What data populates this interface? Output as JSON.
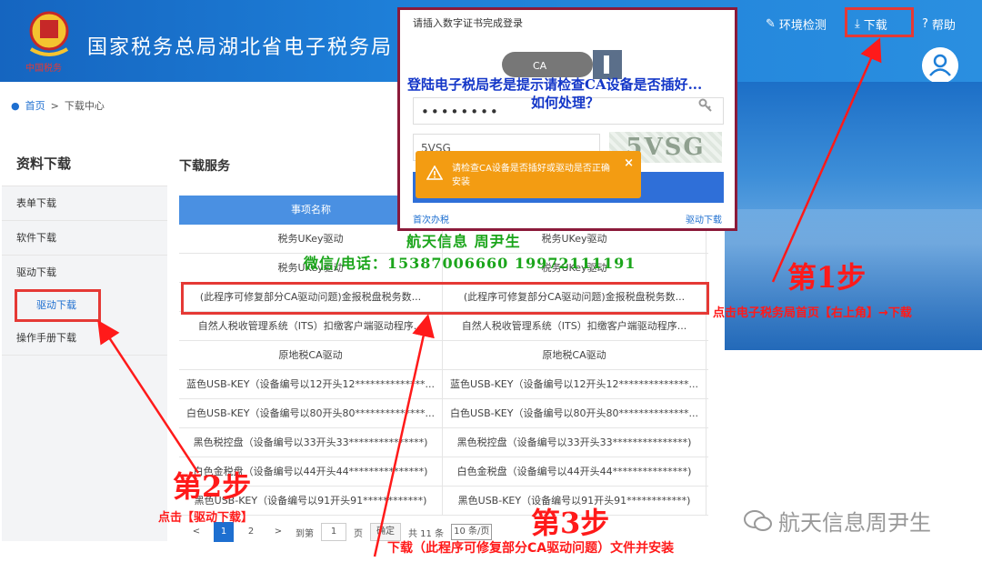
{
  "header": {
    "site_title": "国家税务总局湖北省电子税务局",
    "emblem_text": "中国税务",
    "env_check_label": "环境检测",
    "download_label": "下载",
    "help_label": "帮助",
    "login_label": "登录"
  },
  "breadcrumb": {
    "home": "首页",
    "separator": ">",
    "current": "下载中心"
  },
  "sidebar": {
    "title": "资料下载",
    "items": [
      {
        "label": "表单下载"
      },
      {
        "label": "软件下载"
      },
      {
        "label": "驱动下载"
      }
    ],
    "sub_item": "驱动下载",
    "last_item": "操作手册下载"
  },
  "main": {
    "title": "下载服务",
    "table": {
      "header": "事项名称",
      "rows": [
        [
          "税务UKey驱动",
          "税务UKey驱动"
        ],
        [
          "税务UKey驱动",
          "税务UKey驱动"
        ],
        [
          "(此程序可修复部分CA驱动问题)金报税盘税务数...",
          "(此程序可修复部分CA驱动问题)金报税盘税务数..."
        ],
        [
          "自然人税收管理系统（ITS）扣缴客户端驱动程序...",
          "自然人税收管理系统（ITS）扣缴客户端驱动程序..."
        ],
        [
          "原地税CA驱动",
          "原地税CA驱动"
        ],
        [
          "蓝色USB-KEY（设备编号以12开头12**************...",
          "蓝色USB-KEY（设备编号以12开头12**************..."
        ],
        [
          "白色USB-KEY（设备编号以80开头80**************...",
          "白色USB-KEY（设备编号以80开头80**************..."
        ],
        [
          "黑色税控盘（设备编号以33开头33***************)",
          "黑色税控盘（设备编号以33开头33***************)"
        ],
        [
          "白色金税盘（设备编号以44开头44***************)",
          "白色金税盘（设备编号以44开头44***************)"
        ],
        [
          "黑色USB-KEY（设备编号以91开头91************)",
          "黑色USB-KEY（设备编号以91开头91************)"
        ]
      ]
    },
    "pager": {
      "prev": "<",
      "page1": "1",
      "page2": "2",
      "next": ">",
      "goto_label": "到第",
      "goto_value": "1",
      "page_unit": "页",
      "confirm": "确定",
      "total": "共 11 条",
      "page_size": "10 条/页"
    }
  },
  "popup": {
    "title": "请插入数字证书完成登录",
    "usb_label": "CA",
    "password_mask": "••••••••",
    "captcha_value": "5VSG",
    "captcha_image_text": "5VSG",
    "link_left": "首次办税",
    "link_right": "驱动下载",
    "warning": "请检查CA设备是否插好或驱动是否正确安装",
    "warning_close": "×"
  },
  "overlay": {
    "question_line1": "登陆电子税局老是提示请检查CA设备是否插好...",
    "question_line2": "如何处理？",
    "watermark_name": "航天信息  周尹生",
    "watermark_contact": "微信/电话：15387006660    19972111191",
    "step1": "第1步",
    "step1_desc": "点击电子税务局首页【右上角】→下载",
    "step2": "第2步",
    "step2_desc": "点击【驱动下载】",
    "step3": "第3步",
    "step3_desc": "下载（此程序可修复部分CA驱动问题）文件并安装",
    "brand": "航天信息周尹生"
  },
  "colors": {
    "header_blue": "#1e7fd8",
    "table_header": "#4a90e2",
    "annotation_red": "#ff1a1a",
    "warning_orange": "#f39c12",
    "question_blue": "#1437c8",
    "watermark_green": "#1ba51b"
  }
}
